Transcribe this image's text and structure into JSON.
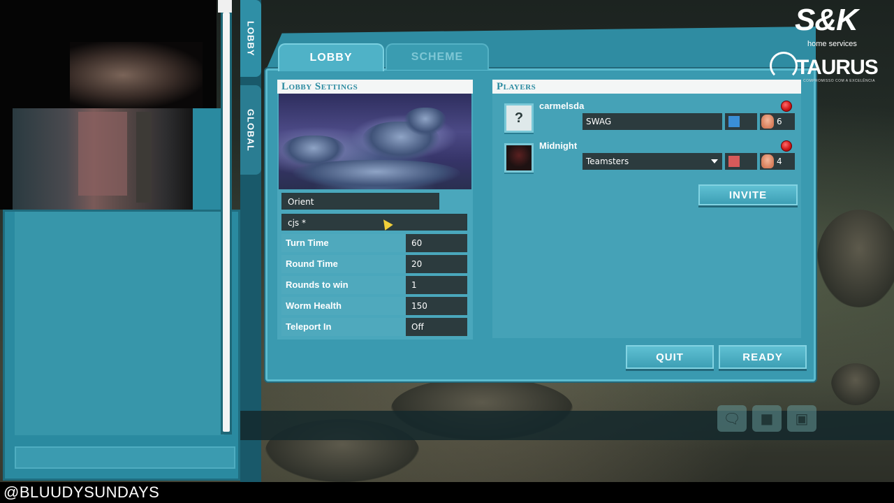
{
  "stream": {
    "handle": "@BLUUDYSUNDAYS"
  },
  "side_tabs": {
    "lobby": "LOBBY",
    "global": "GLOBAL"
  },
  "tabs": {
    "lobby": "LOBBY",
    "scheme": "SCHEME"
  },
  "lobby_settings": {
    "header": "Lobby Settings",
    "map_name": "Orient",
    "scheme_name": "cjs *",
    "settings": [
      {
        "label": "Turn Time",
        "value": "60"
      },
      {
        "label": "Round Time",
        "value": "20"
      },
      {
        "label": "Rounds to win",
        "value": "1"
      },
      {
        "label": "Worm Health",
        "value": "150"
      },
      {
        "label": "Teleport In",
        "value": "Off"
      }
    ]
  },
  "players": {
    "header": "Players",
    "list": [
      {
        "name": "carmelsda",
        "avatar": "question-mark",
        "avatar_text": "?",
        "team": "SWAG",
        "color": "#3a8fd6",
        "worms": "6",
        "ready": false
      },
      {
        "name": "Midnight",
        "avatar": "photo",
        "avatar_text": "",
        "team": "Teamsters",
        "color": "#d65a5a",
        "worms": "4",
        "ready": false
      }
    ],
    "invite_label": "INVITE"
  },
  "actions": {
    "quit_label": "QUIT",
    "ready_label": "READY"
  },
  "branding": {
    "sk_logo": "S&K",
    "sk_sub": "home services",
    "taurus_logo": "TAURUS",
    "taurus_sub": "COMPROMISSO COM A EXCELÊNCIA"
  },
  "icons": {
    "chat": "chat-bubble-icon",
    "lobby": "lobby-icon",
    "screen": "screen-icon"
  },
  "colors": {
    "panel": "#3a9ab0",
    "header_text": "#2a8aa0",
    "ready_dot": "#d01a1a"
  }
}
